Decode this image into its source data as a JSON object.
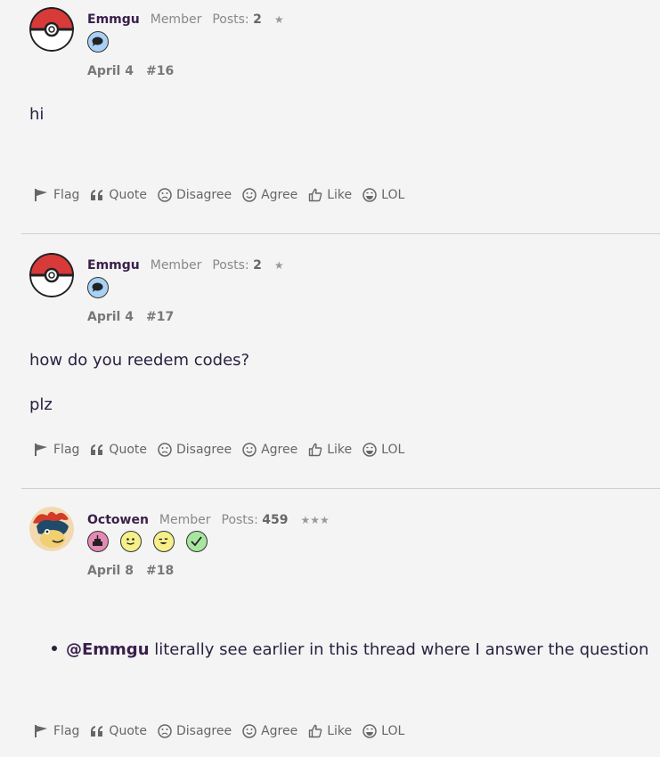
{
  "posts": [
    {
      "username": "Emmgu",
      "role": "Member",
      "posts_label": "Posts:",
      "posts_count": "2",
      "stars": "★",
      "badges": [
        "speech-bubble-badge"
      ],
      "date": "April 4",
      "number": "#16",
      "body": [
        "hi"
      ],
      "avatar": "pokeball"
    },
    {
      "username": "Emmgu",
      "role": "Member",
      "posts_label": "Posts:",
      "posts_count": "2",
      "stars": "★",
      "badges": [
        "speech-bubble-badge"
      ],
      "date": "April 4",
      "number": "#17",
      "body": [
        "how do you reedem codes?",
        "plz"
      ],
      "avatar": "pokeball"
    },
    {
      "username": "Octowen",
      "role": "Member",
      "posts_label": "Posts:",
      "posts_count": "459",
      "stars": "★★★",
      "badges": [
        "cake-badge",
        "smile-badge",
        "wink-badge",
        "check-badge"
      ],
      "date": "April 8",
      "number": "#18",
      "mention": "@Emmgu",
      "body_rest": " literally see earlier in this thread where I answer the question",
      "avatar": "typhlosion"
    }
  ],
  "actions": {
    "flag": "Flag",
    "quote": "Quote",
    "disagree": "Disagree",
    "agree": "Agree",
    "like": "Like",
    "lol": "LOL"
  },
  "colors": {
    "background": "#f4f4f4",
    "username": "#3a1f4a",
    "text": "#2a2140",
    "pokeball_red": "#d83a3a",
    "badge_blue": "#a9d1f5",
    "badge_pink": "#e58ab5",
    "badge_yellow": "#f5f08a",
    "badge_green": "#a8e6a0"
  }
}
